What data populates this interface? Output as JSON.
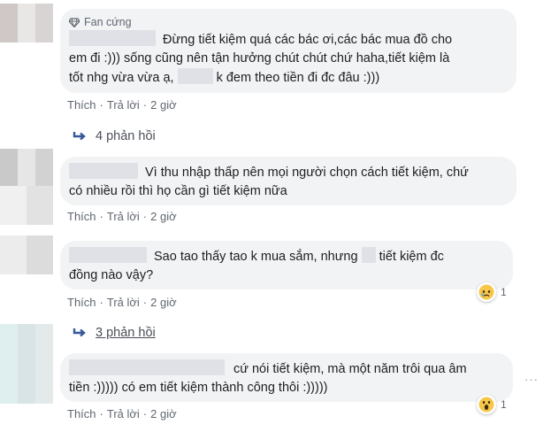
{
  "comments": [
    {
      "badge": "Fan cứng",
      "line1": "Đừng tiết kiệm quá các bác ơi,các bác mua đồ cho",
      "line2": "em đi :))) sống cũng nên tận hưởng chút chút chứ haha,tiết kiệm là",
      "line3_a": "tốt nhg vừa vừa ạ,",
      "line3_b": "k đem theo tiền đi đc đâu :)))",
      "actions": {
        "like": "Thích",
        "reply": "Trả lời",
        "time": "2 giờ"
      },
      "replies": "4 phản hồi"
    },
    {
      "line1": "Vì thu nhập thấp nên mọi người chọn cách tiết kiệm, chứ",
      "line2": "có nhiều rồi thì họ cần gì tiết kiệm nữa",
      "actions": {
        "like": "Thích",
        "reply": "Trả lời",
        "time": "2 giờ"
      }
    },
    {
      "line1_a": "Sao tao thấy tao k mua sắm, nhưng",
      "line1_b": "tiết kiệm đc",
      "line2": "đồng nào vậy?",
      "actions": {
        "like": "Thích",
        "reply": "Trả lời",
        "time": "2 giờ"
      },
      "reaction_count": "1",
      "replies": "3 phản hồi"
    },
    {
      "line1": "cứ nói tiết kiệm, mà một năm trôi qua âm",
      "line2": "tiền :))))) có em tiết kiệm thành công thôi :)))))",
      "actions": {
        "like": "Thích",
        "reply": "Trả lời",
        "time": "2 giờ"
      },
      "reaction_count": "1",
      "more": "···"
    }
  ]
}
